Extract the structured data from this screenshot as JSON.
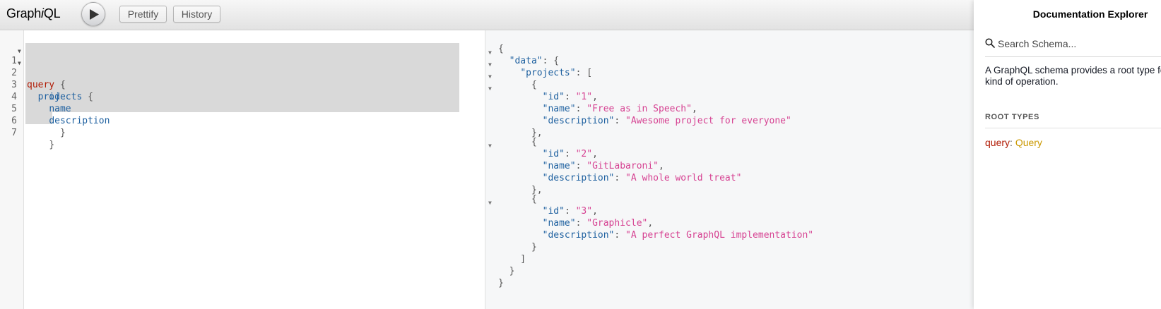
{
  "app": {
    "logo_prefix": "Graph",
    "logo_italic": "i",
    "logo_suffix": "QL"
  },
  "toolbar": {
    "prettify_label": "Prettify",
    "history_label": "History",
    "run_icon": "play-icon"
  },
  "query_editor": {
    "lines": [
      {
        "num": "1",
        "fold": true
      },
      {
        "num": "2",
        "fold": true
      },
      {
        "num": "3",
        "fold": false
      },
      {
        "num": "4",
        "fold": false
      },
      {
        "num": "5",
        "fold": false
      },
      {
        "num": "6",
        "fold": false
      },
      {
        "num": "7",
        "fold": false
      }
    ],
    "tokens": {
      "query_kw": "query",
      "projects": "projects",
      "id": "id",
      "name": "name",
      "description": "description",
      "open_brace": "{",
      "close_brace": "}"
    }
  },
  "result": {
    "data_key": "\"data\"",
    "projects_key": "\"projects\"",
    "id_key": "\"id\"",
    "name_key": "\"name\"",
    "description_key": "\"description\"",
    "items": [
      {
        "id": "\"1\"",
        "name": "\"Free as in Speech\"",
        "description": "\"Awesome project for everyone\""
      },
      {
        "id": "\"2\"",
        "name": "\"GitLabaroni\"",
        "description": "\"A whole world treat\""
      },
      {
        "id": "\"3\"",
        "name": "\"Graphicle\"",
        "description": "\"A perfect GraphQL implementation\""
      }
    ]
  },
  "docs": {
    "title": "Documentation Explorer",
    "search_placeholder": "Search Schema...",
    "search_icon": "search-icon",
    "description_line1": "A GraphQL schema provides a root type for each",
    "description_line2": "kind of operation.",
    "root_types_title": "ROOT TYPES",
    "root_type_key": "query",
    "root_type_value": "Query"
  },
  "colors": {
    "keyword": "#b11a04",
    "field": "#1f61a0",
    "string": "#d64292",
    "type": "#ca9800"
  }
}
